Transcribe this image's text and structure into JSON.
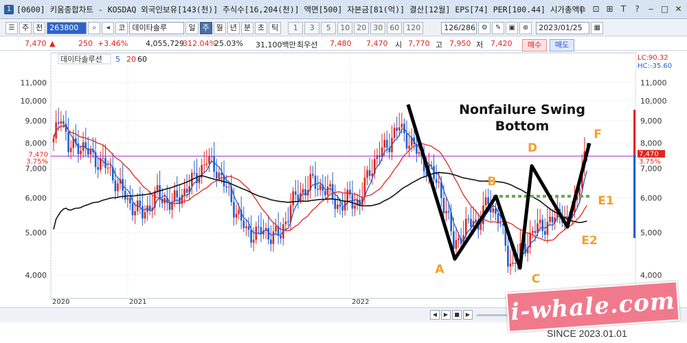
{
  "window": {
    "icon": "1",
    "title": "[0600] 키움종합차트 - KOSDAQ 외국인보유[143(천)] 주식수[16,204(천)] 액면[500] 자본금[81(억)] 결산[12월] EPS[74] PER[100.44] 시가총액[",
    "buttons": [
      "⧉",
      "⊡",
      "⊞",
      "T",
      "?",
      "‒",
      "□",
      "✕"
    ]
  },
  "toolbar": {
    "market": "코",
    "market2": "주",
    "market3": "전",
    "code": "263800",
    "name": "데이타솔루",
    "periods": [
      "일",
      "주",
      "월",
      "년",
      "분",
      "초",
      "틱"
    ],
    "active_period": "주",
    "intervals": [
      "1",
      "3",
      "5",
      "10",
      "20",
      "30",
      "60",
      "120"
    ],
    "count": "126/286",
    "date": "2023/01/25"
  },
  "quote": {
    "price": "7,470",
    "arrow": "▲",
    "change": "250",
    "change_pct": "+3.46%",
    "volume": "4,055,729",
    "vol_ratio": "312.04%",
    "turnover": "25.03%",
    "amount": "31,100백만",
    "best_ask_label": "최우선",
    "best_ask": "7,480",
    "best_bid": "7,470",
    "open_label": "시",
    "open": "7,770",
    "high_label": "고",
    "high": "7,950",
    "low_label": "저",
    "low": "7,420",
    "buy_label": "매수",
    "sell_label": "매도"
  },
  "chart_data": {
    "type": "candlestick",
    "legend": [
      "데이타솔루션",
      "5",
      "20",
      "60"
    ],
    "legend_colors": [
      "#333333",
      "#1f5fd0",
      "#e0251f",
      "#111111"
    ],
    "x_labels": [
      "2020",
      "2021",
      "2022"
    ],
    "y_ticks": [
      4000,
      5000,
      6000,
      7000,
      8000,
      9000,
      10000,
      11000
    ],
    "y_tick_labels": [
      "4,000",
      "5,000",
      "6,000",
      "7,000",
      "8,000",
      "9,000",
      "10,000",
      "11,000"
    ],
    "y_scale": "log",
    "ylim": [
      3800,
      12500
    ],
    "current_price": 7470,
    "current_price_label": "7,470",
    "current_pct_label": "3.75%",
    "lc_label": "LC:90.32",
    "hc_label": "HC:-35.60",
    "annotation_title": [
      "Nonfailure Swing",
      "Bottom"
    ],
    "swing_points": {
      "A": 4350,
      "B": 6050,
      "C": 4150,
      "D": 7100,
      "E1": 6050,
      "E2": 5150,
      "F": 8000
    },
    "point_labels": [
      "A",
      "B",
      "C",
      "D",
      "E1",
      "E2",
      "F"
    ],
    "colors": {
      "up": "#e0251f",
      "down": "#1f5fd0",
      "ma5": "#1f5fd0",
      "ma20": "#e0251f",
      "ma60": "#111111",
      "swing": "#000000",
      "labels": "#f0a030",
      "level": "#6aa84f",
      "price_line": "#9b30d0"
    }
  },
  "bottom": {
    "nav": [
      "◀",
      "▶",
      "■",
      "▶"
    ]
  },
  "watermark": {
    "text": "i-whale.com",
    "since": "SINCE 2023.01.01"
  }
}
